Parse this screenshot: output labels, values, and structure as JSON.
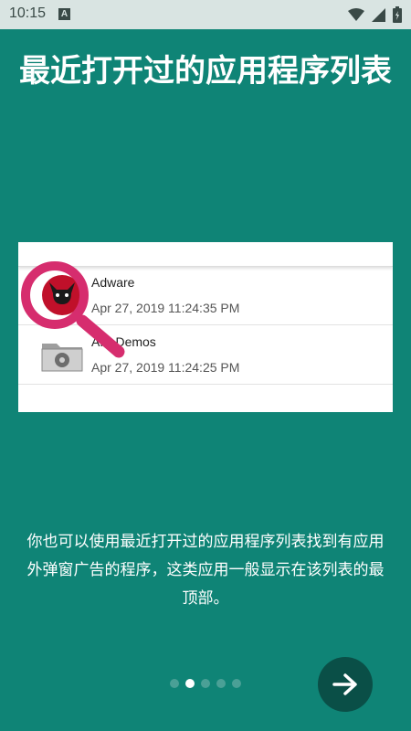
{
  "status_bar": {
    "time": "10:15",
    "notification_icon": "a-letter-icon",
    "icons": [
      "wifi-icon",
      "signal-icon",
      "battery-icon"
    ]
  },
  "headline": "最近打开过的应用程序列表",
  "preview": {
    "apps": [
      {
        "name": "Adware",
        "time": "Apr 27, 2019 11:24:35 PM",
        "icon": "adware-devil-icon"
      },
      {
        "name": "API Demos",
        "time": "Apr 27, 2019 11:24:25 PM",
        "icon": "folder-gear-icon"
      }
    ],
    "magnifier_icon": "magnifier-icon"
  },
  "description": "你也可以使用最近打开过的应用程序列表找到有应用外弹窗广告的程序，这类应用一般显示在该列表的最顶部。",
  "pager": {
    "total_pages": 5,
    "current_page": 2
  },
  "next_button": {
    "icon": "arrow-right-icon"
  },
  "colors": {
    "background": "#0f8476",
    "next_button": "#0a4f47",
    "magnifier": "#d62d6e",
    "adware_icon": "#c0102a"
  }
}
